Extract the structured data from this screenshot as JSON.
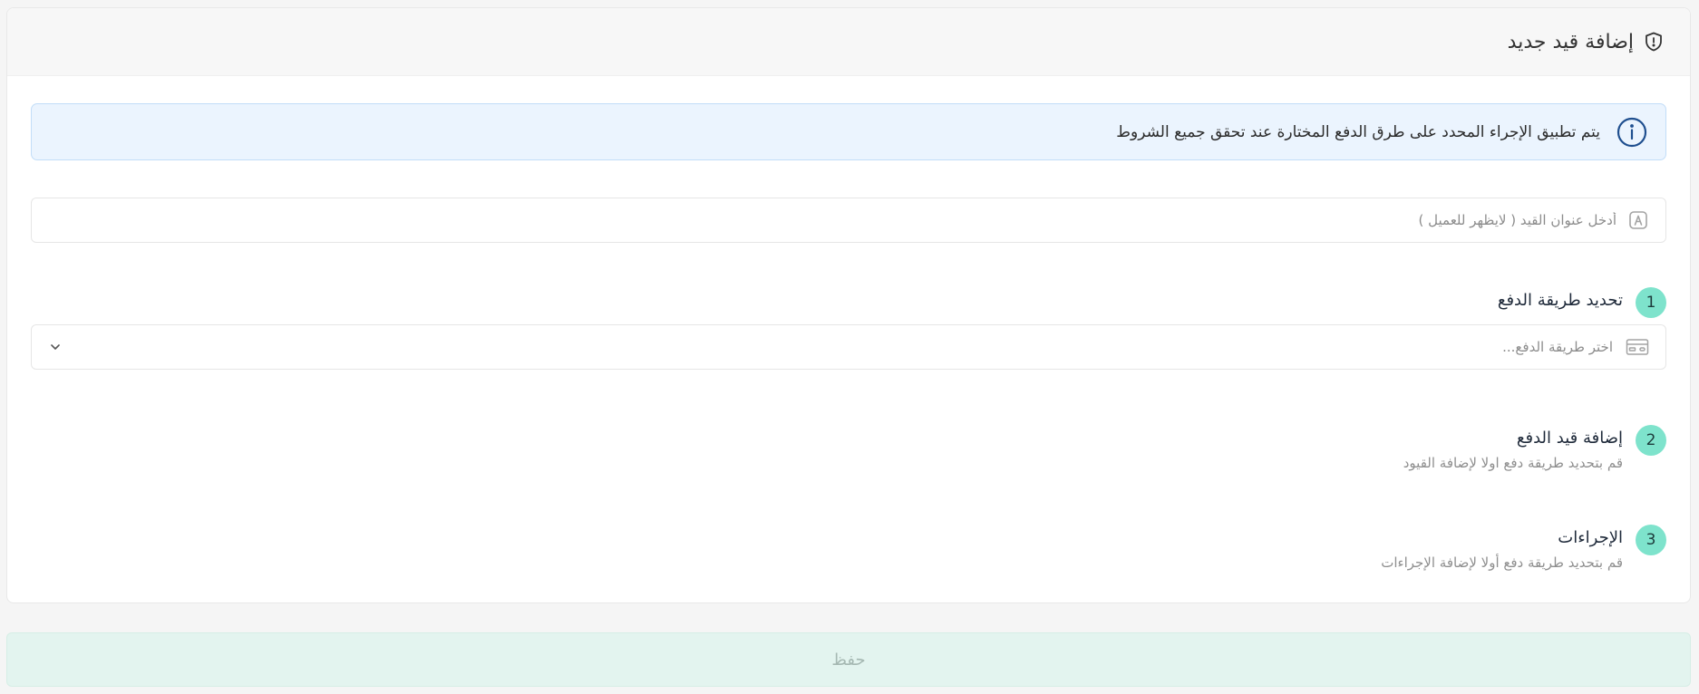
{
  "header": {
    "title": "إضافة قيد جديد",
    "icon": "shield-alert-icon"
  },
  "info_alert": {
    "icon": "info-circle-icon",
    "text": "يتم تطبيق الإجراء المحدد على طرق الدفع المختارة عند تحقق جميع الشروط"
  },
  "rule_title_input": {
    "icon": "text-field-icon",
    "placeholder": "أدخل عنوان القيد ( لايظهر للعميل )",
    "value": ""
  },
  "steps": [
    {
      "number": "1",
      "title": "تحديد طريقة الدفع",
      "subtitle": ""
    },
    {
      "number": "2",
      "title": "إضافة قيد الدفع",
      "subtitle": "قم بتحديد طريقة دفع اولا لإضافة القيود"
    },
    {
      "number": "3",
      "title": "الإجراءات",
      "subtitle": "قم بتحديد طريقة دفع أولا لإضافة الإجراءات"
    }
  ],
  "payment_select": {
    "icon": "credit-card-icon",
    "placeholder": "اختر طريقة الدفع...",
    "chevron": "chevron-down-icon"
  },
  "save_button": {
    "label": "حفظ",
    "disabled": true
  },
  "colors": {
    "accent": "#7ee3cc",
    "info_bg": "#ebf4fe",
    "info_border": "#c2ddf8",
    "info_icon": "#1f4f8f",
    "save_bg": "#e3f4ef",
    "save_text": "#a5b8b2"
  }
}
